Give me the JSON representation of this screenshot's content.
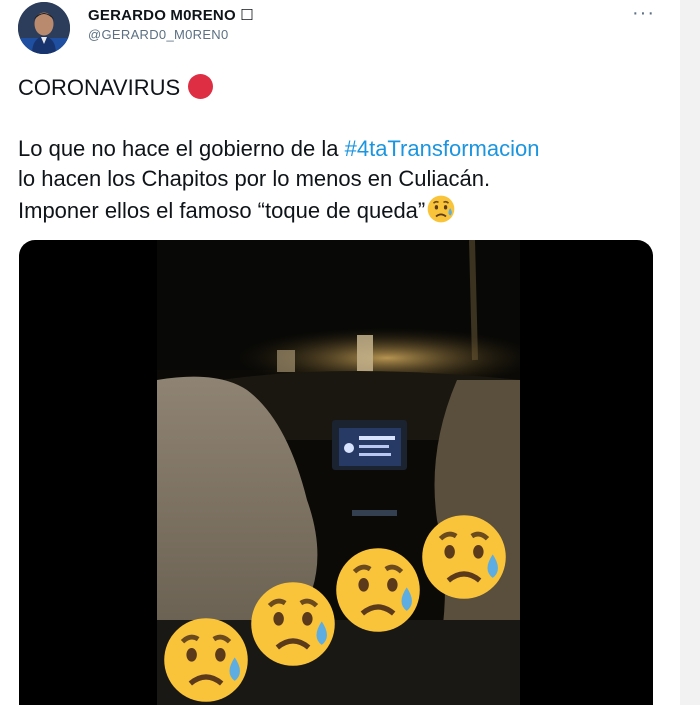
{
  "tweet": {
    "author": {
      "display_name": "GERARDO M0RENO ☐",
      "handle": "@GERARD0_M0REN0"
    },
    "headline": "CORONAVIRUS",
    "body_lines": [
      {
        "before": "Lo que no hace el gobierno de la ",
        "hashtag": "#4taTransformacion"
      },
      {
        "text": "lo hacen los Chapitos por lo menos en Culiacán."
      },
      {
        "text": "Imponer ellos el famoso “toque de queda”"
      }
    ],
    "more_icon": "···",
    "media": {
      "type": "video",
      "overlay_emoji": "sad-but-relieved-face",
      "overlay_emoji_count": 4
    }
  },
  "colors": {
    "hashtag": "#1b95e0",
    "red_circle": "#dd2e44",
    "handle": "#5b7083",
    "emoji_face": "#f9c33a"
  },
  "icons": [
    "avatar-photo",
    "red-circle-icon",
    "sad-relieved-emoji",
    "more-icon"
  ]
}
